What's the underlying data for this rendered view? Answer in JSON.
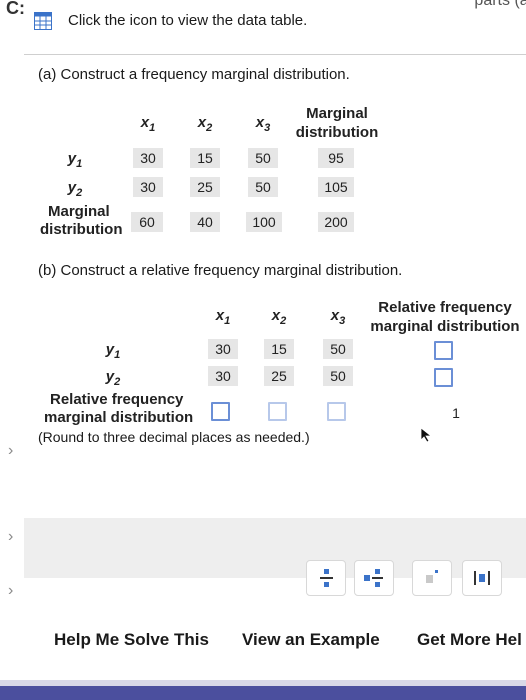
{
  "top_cut": {
    "left": "C:",
    "right": "parts (a)"
  },
  "toolbar": {
    "label": "Click the icon to view the data table.",
    "icon": "grid-icon"
  },
  "part_a": {
    "title": "(a) Construct a frequency marginal distribution.",
    "col_headers": [
      "x",
      "x",
      "x"
    ],
    "col_subs": [
      "1",
      "2",
      "3"
    ],
    "marginal_header": [
      "Marginal",
      "distribution"
    ],
    "rows": [
      {
        "label": "y",
        "sub": "1",
        "values": [
          "30",
          "15",
          "50"
        ],
        "marginal": "95"
      },
      {
        "label": "y",
        "sub": "2",
        "values": [
          "30",
          "25",
          "50"
        ],
        "marginal": "105"
      }
    ],
    "marginal_row": {
      "label": [
        "Marginal",
        "distribution"
      ],
      "values": [
        "60",
        "40",
        "100"
      ],
      "total": "200"
    }
  },
  "part_b": {
    "title": "(b) Construct a relative frequency marginal distribution.",
    "col_headers": [
      "x",
      "x",
      "x"
    ],
    "col_subs": [
      "1",
      "2",
      "3"
    ],
    "marginal_header": [
      "Relative frequency",
      "marginal distribution"
    ],
    "rows": [
      {
        "label": "y",
        "sub": "1",
        "values": [
          "30",
          "15",
          "50"
        ]
      },
      {
        "label": "y",
        "sub": "2",
        "values": [
          "30",
          "25",
          "50"
        ]
      }
    ],
    "marginal_row": {
      "label": [
        "Relative frequency",
        "marginal distribution"
      ],
      "total": "1"
    },
    "note": "(Round to three decimal places as needed.)"
  },
  "tool_buttons": [
    "fraction-icon",
    "mixed-number-icon",
    "exponent-icon",
    "absolute-value-icon"
  ],
  "bottom_links": [
    "Help Me Solve This",
    "View an Example",
    "Get More Hel"
  ],
  "colors": {
    "accent": "#4b4f9e",
    "box_border": "#6b8fd6",
    "shaded": "#e6e6e6"
  }
}
